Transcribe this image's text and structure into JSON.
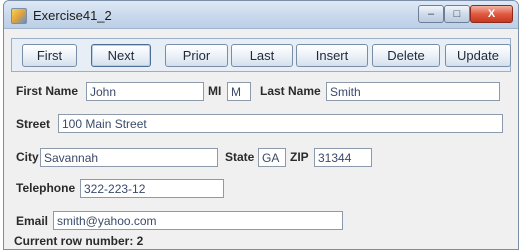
{
  "window": {
    "title": "Exercise41_2",
    "min_glyph": "–",
    "max_glyph": "□",
    "close_glyph": "X"
  },
  "toolbar": {
    "first_label": "First",
    "next_label": "Next",
    "prior_label": "Prior",
    "last_label": "Last",
    "insert_label": "Insert",
    "delete_label": "Delete",
    "update_label": "Update"
  },
  "form": {
    "first_name": {
      "label": "First Name",
      "value": "John"
    },
    "mi": {
      "label": "MI",
      "value": "M"
    },
    "last_name": {
      "label": "Last Name",
      "value": "Smith"
    },
    "street": {
      "label": "Street",
      "value": "100 Main Street"
    },
    "city": {
      "label": "City",
      "value": "Savannah"
    },
    "state": {
      "label": "State",
      "value": "GA"
    },
    "zip": {
      "label": "ZIP",
      "value": "31344"
    },
    "telephone": {
      "label": "Telephone",
      "value": "322-223-12"
    },
    "email": {
      "label": "Email",
      "value": "smith@yahoo.com"
    }
  },
  "status": {
    "text": "Current row number: 2"
  },
  "colors": {
    "titlebar": "#c9d9ec",
    "close_button": "#e05a42",
    "field_text": "#3a4a6a"
  }
}
